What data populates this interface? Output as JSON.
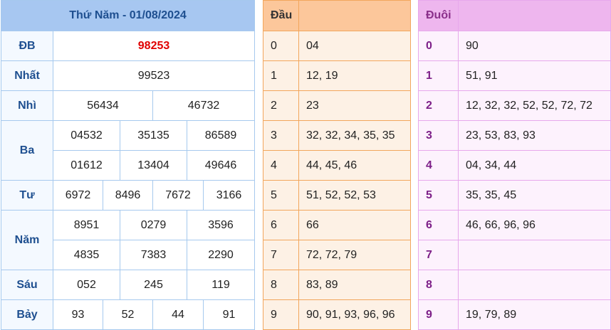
{
  "results": {
    "title": "Thứ Năm - 01/08/2024",
    "prizes": {
      "db": {
        "label": "ĐB",
        "values": [
          "98253"
        ]
      },
      "nhat": {
        "label": "Nhất",
        "values": [
          "99523"
        ]
      },
      "nhi": {
        "label": "Nhì",
        "values": [
          "56434",
          "46732"
        ]
      },
      "ba": {
        "label": "Ba",
        "values": [
          "04532",
          "35135",
          "86589",
          "01612",
          "13404",
          "49646"
        ]
      },
      "tu": {
        "label": "Tư",
        "values": [
          "6972",
          "8496",
          "7672",
          "3166"
        ]
      },
      "nam": {
        "label": "Năm",
        "values": [
          "8951",
          "0279",
          "3596",
          "4835",
          "7383",
          "2290"
        ]
      },
      "sau": {
        "label": "Sáu",
        "values": [
          "052",
          "245",
          "119"
        ]
      },
      "bay": {
        "label": "Bảy",
        "values": [
          "93",
          "52",
          "44",
          "91"
        ]
      }
    }
  },
  "head": {
    "title": "Đầu",
    "rows": [
      {
        "digit": "0",
        "values": "04"
      },
      {
        "digit": "1",
        "values": "12, 19"
      },
      {
        "digit": "2",
        "values": "23"
      },
      {
        "digit": "3",
        "values": "32, 32, 34, 35, 35"
      },
      {
        "digit": "4",
        "values": "44, 45, 46"
      },
      {
        "digit": "5",
        "values": "51, 52, 52, 53"
      },
      {
        "digit": "6",
        "values": "66"
      },
      {
        "digit": "7",
        "values": "72, 72, 79"
      },
      {
        "digit": "8",
        "values": "83, 89"
      },
      {
        "digit": "9",
        "values": "90, 91, 93, 96, 96"
      }
    ]
  },
  "tail": {
    "title": "Đuôi",
    "rows": [
      {
        "digit": "0",
        "values": "90"
      },
      {
        "digit": "1",
        "values": "51, 91"
      },
      {
        "digit": "2",
        "values": "12, 32, 32, 52, 52, 72, 72"
      },
      {
        "digit": "3",
        "values": "23, 53, 83, 93"
      },
      {
        "digit": "4",
        "values": "04, 34, 44"
      },
      {
        "digit": "5",
        "values": "35, 35, 45"
      },
      {
        "digit": "6",
        "values": "46, 66, 96, 96"
      },
      {
        "digit": "7",
        "values": ""
      },
      {
        "digit": "8",
        "values": ""
      },
      {
        "digit": "9",
        "values": "19, 79, 89"
      }
    ]
  },
  "colors": {
    "results_header_bg": "#a7c7f1",
    "prize_label": "#1e4f90",
    "special_prize": "#e00000",
    "head_header_bg": "#fcc79b",
    "head_row_bg": "#fdf1e5",
    "tail_header_bg": "#eeb6ee",
    "tail_row_bg": "#fdf2fd",
    "tail_digit": "#7d1f88"
  }
}
